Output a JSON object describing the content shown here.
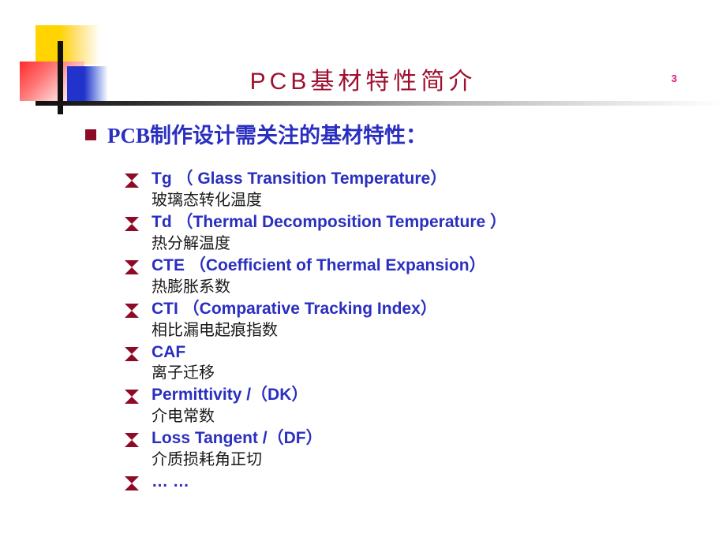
{
  "slide": {
    "page_number": "3",
    "title": "PCB基材特性简介",
    "heading": "PCB制作设计需关注的基材特性：",
    "colors": {
      "title": "#9E1030",
      "heading_text": "#2A2FC0",
      "bullet_marker": "#8E0B28",
      "page_number": "#E8127A",
      "sub_text": "#1a1a1a",
      "logo_yellow": "#FFD400",
      "logo_red": "#FF2A2A",
      "logo_blue": "#2233CC"
    },
    "items": [
      {
        "en": "Tg  （ Glass Transition Temperature）",
        "cn": "玻璃态转化温度"
      },
      {
        "en": "Td  （Thermal Decomposition Temperature ）",
        "cn": "热分解温度"
      },
      {
        "en": "CTE  （Coefficient of Thermal Expansion）",
        "cn": "热膨胀系数"
      },
      {
        "en": "CTI   （Comparative Tracking Index）",
        "cn": "相比漏电起痕指数"
      },
      {
        "en": "CAF",
        "cn": "离子迁移"
      },
      {
        "en": "Permittivity /（DK）",
        "cn": "介电常数"
      },
      {
        "en": "Loss Tangent /（DF）",
        "cn": "介质损耗角正切"
      },
      {
        "en": "… …",
        "cn": ""
      }
    ]
  }
}
